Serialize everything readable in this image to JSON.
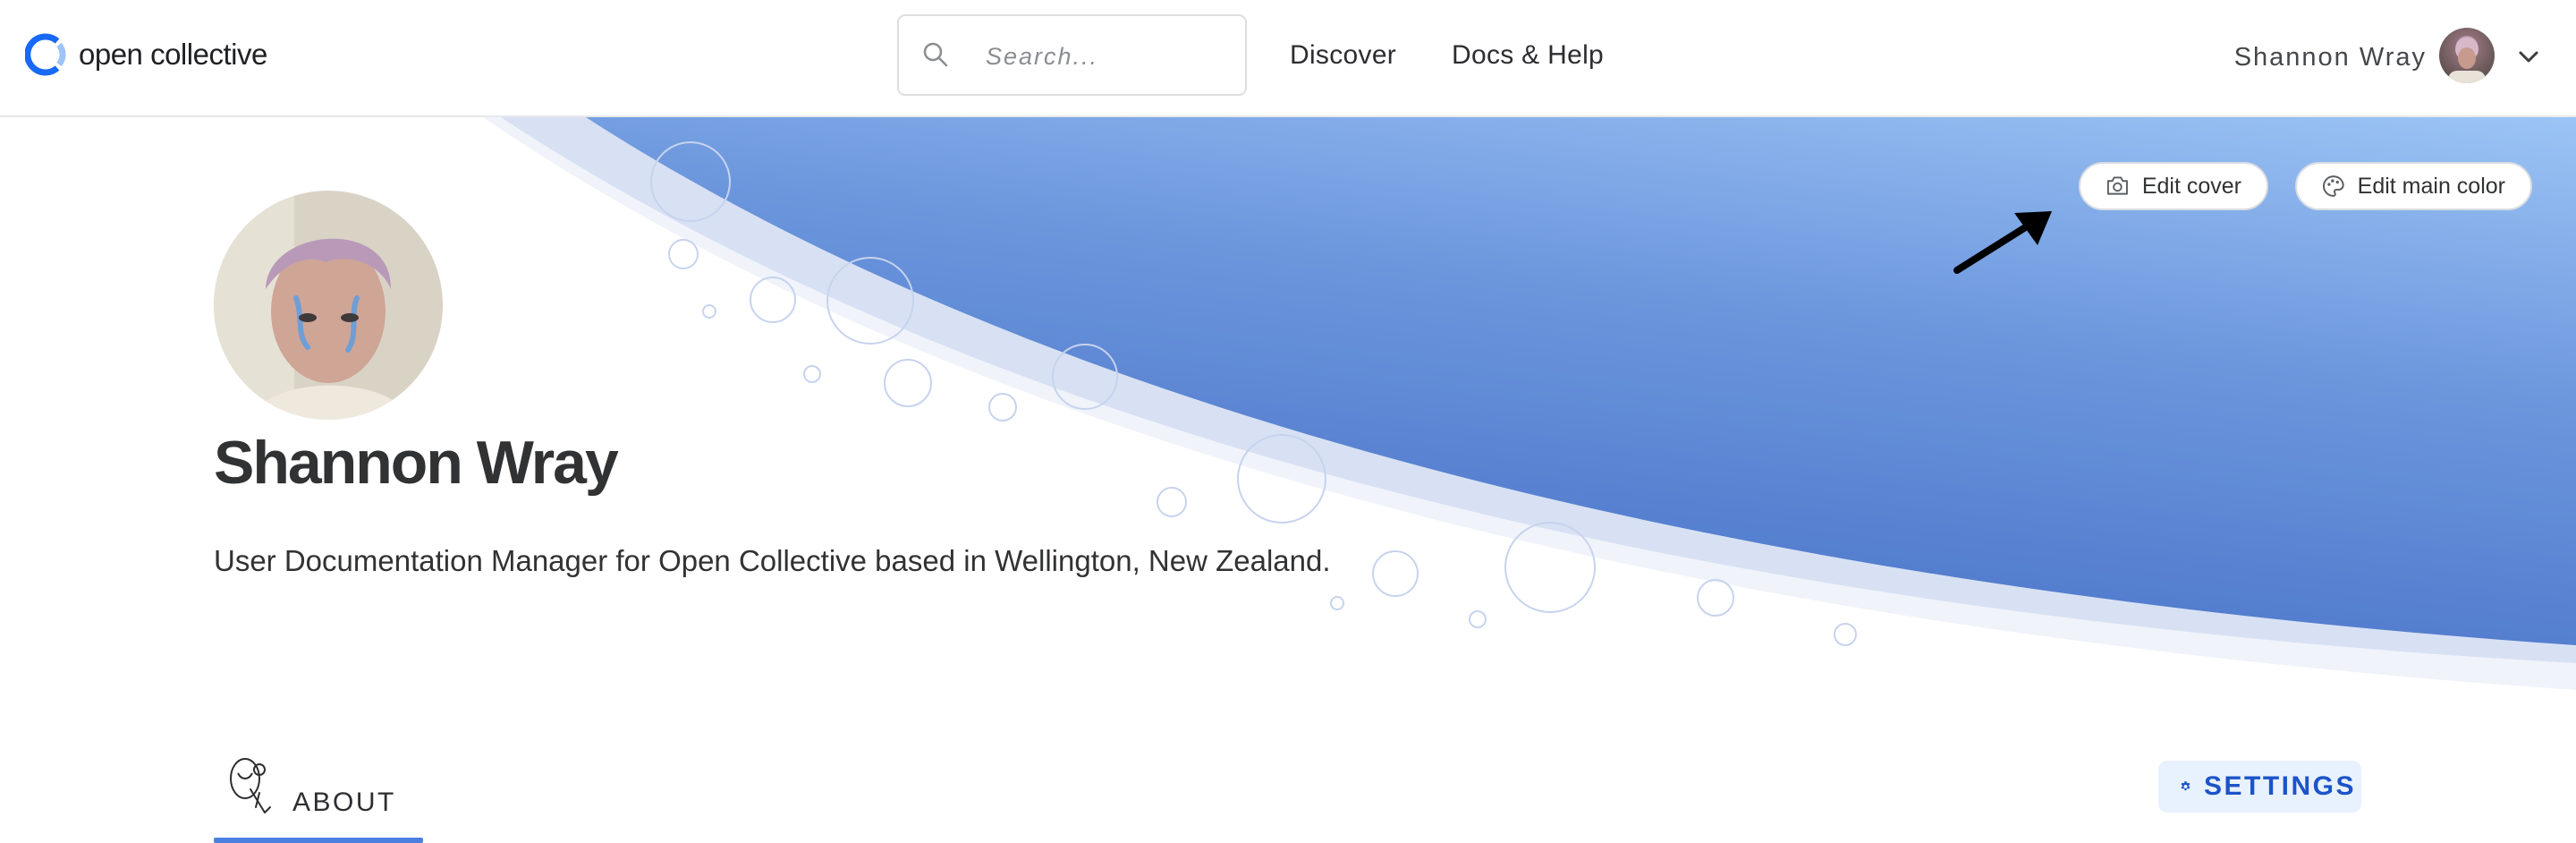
{
  "header": {
    "logo_text": "open collective",
    "search": {
      "placeholder": "Search..."
    },
    "nav": [
      {
        "label": "Discover"
      },
      {
        "label": "Docs & Help"
      }
    ],
    "user": {
      "name": "Shannon Wray"
    }
  },
  "hero": {
    "edit_cover_label": "Edit cover",
    "edit_main_color_label": "Edit main color",
    "cover_color_start": "#4b74c9",
    "cover_color_end": "#9cc4f5"
  },
  "profile": {
    "name": "Shannon Wray",
    "bio": "User Documentation Manager for Open Collective based in Wellington, New Zealand."
  },
  "tabs": {
    "about_label": "ABOUT",
    "settings_label": "SETTINGS"
  },
  "colors": {
    "accent": "#4c80e0",
    "settings_text": "#1b54c8",
    "settings_bg": "#e8f1fe"
  }
}
